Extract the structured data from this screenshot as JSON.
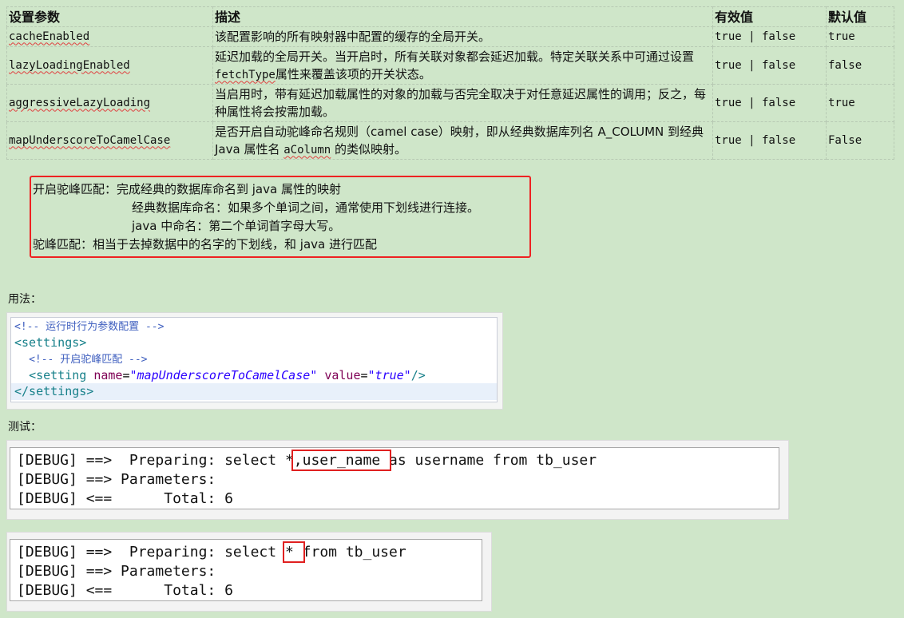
{
  "table": {
    "headers": [
      "设置参数",
      "描述",
      "有效值",
      "默认值"
    ],
    "rows": [
      {
        "param": "cacheEnabled",
        "desc_parts": [
          "该配置影响的所有映射器中配置的缓存的全局开关。"
        ],
        "valid": "true | false",
        "default": "true"
      },
      {
        "param": "lazyLoadingEnabled",
        "desc_parts": [
          "延迟加载的全局开关。当开启时，所有关联对象都会延迟加载。特定关联关系中可通过设置 ",
          "fetchType",
          "属性来覆盖该项的开关状态。"
        ],
        "valid": "true | false",
        "default": "false"
      },
      {
        "param": "aggressiveLazyLoading",
        "desc_parts": [
          "当启用时，带有延迟加载属性的对象的加载与否完全取决于对任意延迟属性的调用；反之，每种属性将会按需加载。"
        ],
        "valid": "true | false",
        "default": "true"
      },
      {
        "param": "mapUnderscoreToCamelCase",
        "desc_parts": [
          "是否开启自动驼峰命名规则（camel case）映射，即从经典数据库列名 A_COLUMN 到经典 Java 属性名 ",
          "aColumn",
          " 的类似映射。"
        ],
        "valid": "true | false",
        "default": "False"
      }
    ]
  },
  "note": {
    "line1": "开启驼峰匹配：完成经典的数据库命名到 java 属性的映射",
    "line2": "经典数据库命名：如果多个单词之间，通常使用下划线进行连接。",
    "line3": "java 中命名：第二个单词首字母大写。",
    "line4": "驼峰匹配：相当于去掉数据中的名字的下划线，和 java 进行匹配"
  },
  "usage_label": "用法：",
  "test_label": "测试：",
  "code": {
    "comment1": "<!-- 运行时行为参数配置 -->",
    "open_tag": "<settings>",
    "comment2": "<!-- 开启驼峰匹配 -->",
    "setting_open": "<setting ",
    "attr_name": "name",
    "eq": "=",
    "name_value": "\"mapUnderscoreToCamelCase\"",
    "attr_value": " value",
    "value_value": "\"true\"",
    "setting_close": "/>",
    "close_tag": "</settings>"
  },
  "console1": {
    "line1_pre": "[DEBUG] ==>  Preparing: select *",
    "line1_hl": ",user_name ",
    "line1_post": "as username from tb_user",
    "line2": "[DEBUG] ==> Parameters: ",
    "line3": "[DEBUG] <==      Total: 6"
  },
  "console2": {
    "line1_pre": "[DEBUG] ==>  Preparing: select ",
    "line1_hl": "* ",
    "line1_post": "from tb_user",
    "line2": "[DEBUG] ==> Parameters: ",
    "line3": "[DEBUG] <==      Total: 6"
  }
}
